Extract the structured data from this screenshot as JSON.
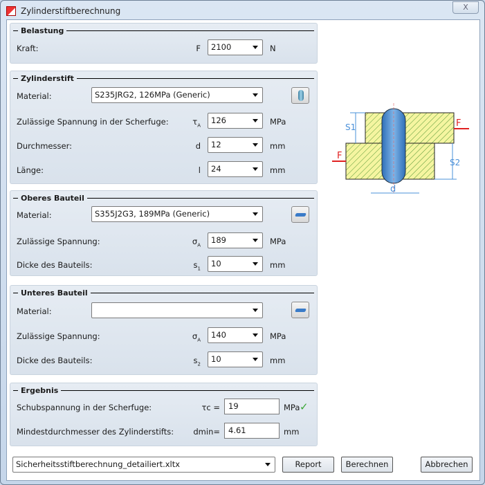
{
  "window": {
    "title": "Zylinderstiftberechnung",
    "close": "X"
  },
  "belastung": {
    "title": "Belastung",
    "kraft": {
      "label": "Kraft:",
      "symbol": "F",
      "value": "2100",
      "unit": "N"
    }
  },
  "zylinderstift": {
    "title": "Zylinderstift",
    "material": {
      "label": "Material:",
      "value": "S235JRG2, 126MPa (Generic)"
    },
    "spannung": {
      "label": "Zulässige Spannung in der Scherfuge:",
      "symbol": "τ",
      "sub": "A",
      "value": "126",
      "unit": "MPa"
    },
    "durchmesser": {
      "label": "Durchmesser:",
      "symbol": "d",
      "value": "12",
      "unit": "mm"
    },
    "laenge": {
      "label": "Länge:",
      "symbol": "l",
      "value": "24",
      "unit": "mm"
    }
  },
  "oberes": {
    "title": "Oberes Bauteil",
    "material": {
      "label": "Material:",
      "value": "S355J2G3, 189MPa (Generic)"
    },
    "spannung": {
      "label": "Zulässige Spannung:",
      "symbol": "σ",
      "sub": "A",
      "value": "189",
      "unit": "MPa"
    },
    "dicke": {
      "label": "Dicke des Bauteils:",
      "symbol": "s",
      "sub": "1",
      "value": "10",
      "unit": "mm"
    }
  },
  "unteres": {
    "title": "Unteres Bauteil",
    "material": {
      "label": "Material:",
      "value": ""
    },
    "spannung": {
      "label": "Zulässige Spannung:",
      "symbol": "σ",
      "sub": "A",
      "value": "140",
      "unit": "MPa"
    },
    "dicke": {
      "label": "Dicke des Bauteils:",
      "symbol": "s",
      "sub": "2",
      "value": "10",
      "unit": "mm"
    }
  },
  "ergebnis": {
    "title": "Ergebnis",
    "schub": {
      "label": "Schubspannung in der Scherfuge:",
      "symbol": "τc =",
      "value": "19",
      "unit": "MPa"
    },
    "dmin": {
      "label": "Mindestdurchmesser des Zylinderstifts:",
      "symbol": "dmin=",
      "value": "4.61",
      "unit": "mm"
    }
  },
  "diagram": {
    "s1": "S1",
    "s2": "S2",
    "d": "d",
    "f": "F"
  },
  "footer": {
    "template": "Sicherheitsstiftberechnung_detailiert.xltx",
    "report": "Report",
    "berechnen": "Berechnen",
    "abbrechen": "Abbrechen"
  },
  "colors": {
    "check": "#3aa635",
    "pin": "#4a90d9",
    "hatch": "#f5f5a0",
    "arrow": "#e02020"
  }
}
